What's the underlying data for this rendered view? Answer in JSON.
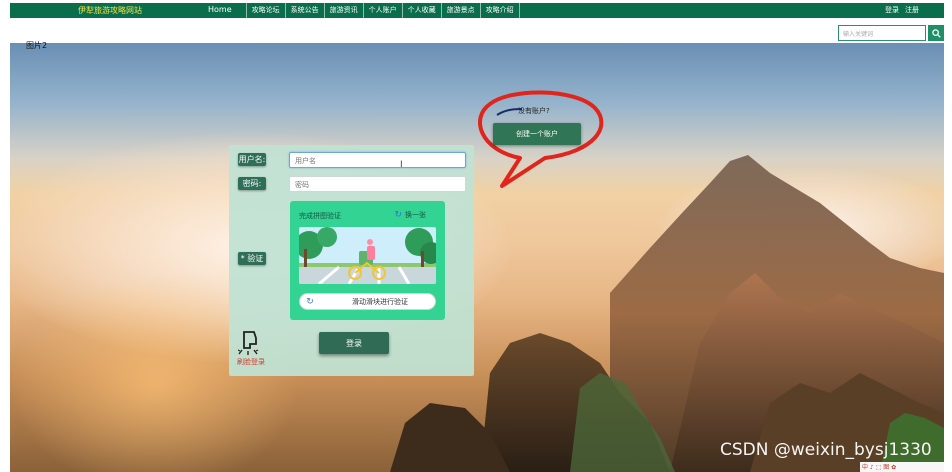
{
  "header": {
    "site_title": "伊犁旅游攻略网站",
    "nav": [
      "Home",
      "攻略论坛",
      "系统公告",
      "旅游资讯",
      "个人账户",
      "个人收藏",
      "旅游景点",
      "攻略介绍"
    ],
    "login": "登录",
    "register": "注册"
  },
  "search": {
    "placeholder": "输入关键词"
  },
  "brand_mark": "图片2",
  "login_form": {
    "username_label": "用户名:",
    "username_placeholder": "用户名",
    "password_label": "密码:",
    "password_placeholder": "密码",
    "verify_label": "* 验证",
    "captcha_title": "完成拼图验证",
    "captcha_refresh": "换一张",
    "slider_text": "滑动滑块进行验证",
    "face_login": "刷脸登录",
    "submit": "登录"
  },
  "register_prompt": {
    "question": "没有账户?",
    "button": "创建一个账户"
  },
  "watermark": "CSDN @weixin_bysj1330",
  "corner_badge": "中 ♪ ⬚ 图 ✿",
  "colors": {
    "nav_bg": "#0a6d4b",
    "title_yellow": "#f2e34a",
    "form_bg": "#c0e2d4",
    "captcha_bg": "#33d394",
    "button_green": "#2f6b55",
    "highlight_red": "#e0251c"
  }
}
